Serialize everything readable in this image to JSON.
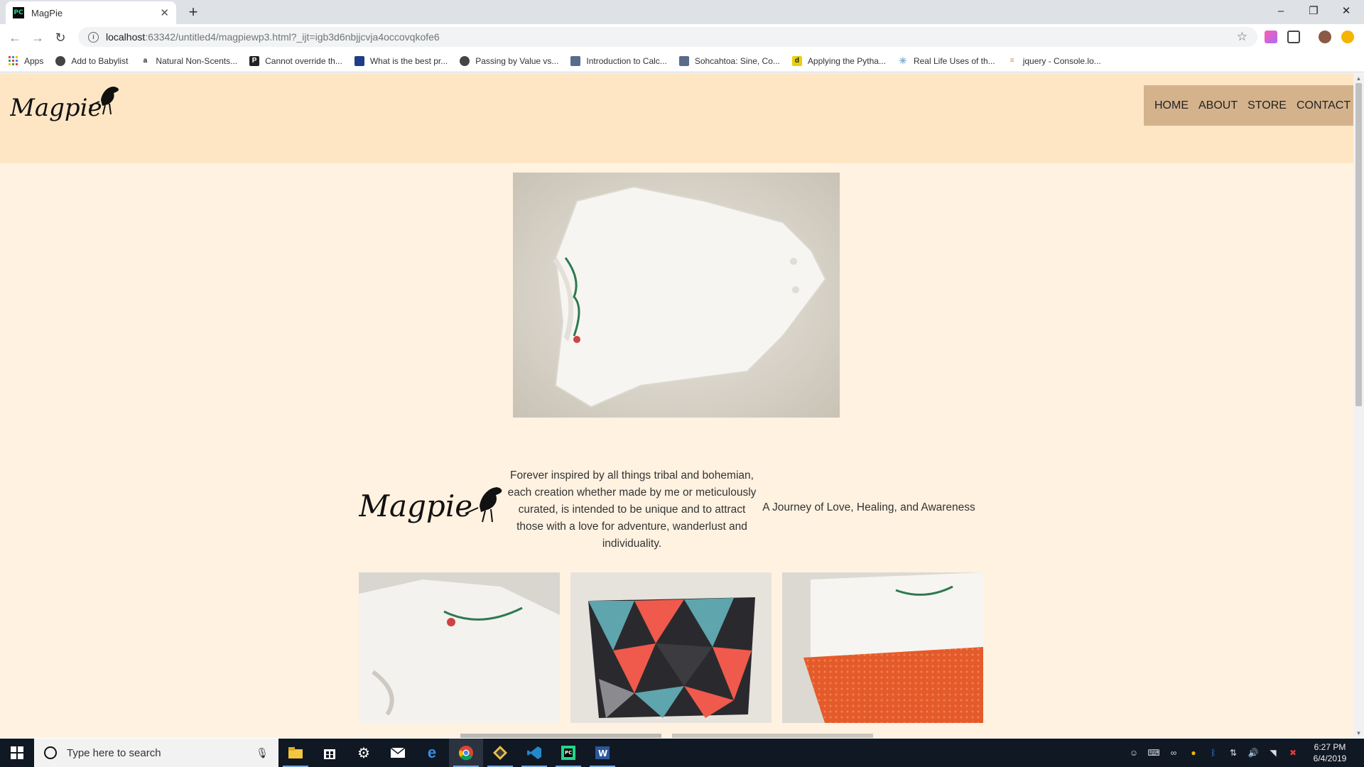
{
  "browser": {
    "tab": {
      "title": "MagPie",
      "favicon": "PC"
    },
    "url": {
      "host": "localhost",
      "rest": ":63342/untitled4/magpiewp3.html?_ijt=igb3d6nbjjcvja4occovqkofe6"
    },
    "bookmarks": [
      {
        "label": "Apps",
        "icon": "apps-grid",
        "color": "#e94235"
      },
      {
        "label": "Add to Babylist",
        "icon": "globe",
        "color": "#444444"
      },
      {
        "label": "Natural Non-Scents...",
        "icon": "amazon",
        "color": "#222222"
      },
      {
        "label": "Cannot override th...",
        "icon": "p-badge",
        "color": "#222222"
      },
      {
        "label": "What is the best pr...",
        "icon": "page",
        "color": "#1f3c88"
      },
      {
        "label": "Passing by Value vs...",
        "icon": "globe",
        "color": "#444444"
      },
      {
        "label": "Introduction to Calc...",
        "icon": "cube",
        "color": "#5a6b8c"
      },
      {
        "label": "Sohcahtoa: Sine, Co...",
        "icon": "cube",
        "color": "#5a6b8c"
      },
      {
        "label": "Applying the Pytha...",
        "icon": "d-badge",
        "color": "#e8d00a"
      },
      {
        "label": "Real Life Uses of th...",
        "icon": "atom",
        "color": "#7fb3d5"
      },
      {
        "label": "jquery - Console.lo...",
        "icon": "stack",
        "color": "#f48024"
      }
    ]
  },
  "site": {
    "logo_text": "Magpie",
    "nav": [
      "HOME",
      "ABOUT",
      "STORE",
      "CONTACT"
    ],
    "tagline": "Forever inspired by all things tribal and bohemian, each creation whether made by me or meticulously curated, is intended to be unique and to attract those with a love for adventure, wanderlust and individuality.",
    "journey": "A Journey of Love, Healing, and Awareness",
    "colors": {
      "header": "#fee6c5",
      "body": "#fff2e1",
      "nav": "#d4b38c"
    }
  },
  "taskbar": {
    "search_placeholder": "Type here to search",
    "time": "6:27 PM",
    "date": "6/4/2019"
  }
}
